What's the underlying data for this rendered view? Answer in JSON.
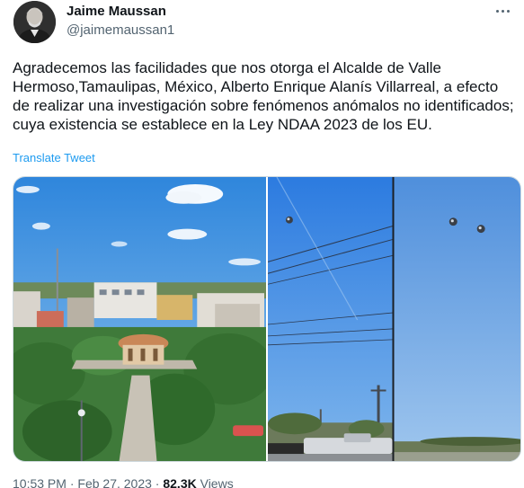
{
  "author": {
    "display_name": "Jaime Maussan",
    "handle": "@jaimemaussan1",
    "avatar_icon": "profile-photo"
  },
  "tweet": {
    "text": "Agradecemos las facilidades que nos otorga el Alcalde de Valle Hermoso,Tamaulipas, México, Alberto Enrique Alanís Villarreal, a efecto de realizar una investigación sobre fenómenos anómalos no identificados; cuya existencia se establece en la Ley NDAA 2023 de los EU.",
    "translate_label": "Translate Tweet",
    "time": "10:53 PM",
    "separator": "·",
    "date": "Feb 27, 2023",
    "views_count": "82.3K",
    "views_label": "Views"
  },
  "media": {
    "photos": [
      {
        "icon": "town-plaza-photo"
      },
      {
        "icon": "sky-objects-photo"
      }
    ]
  },
  "colors": {
    "link": "#1d9bf0",
    "secondary_text": "#536471",
    "primary_text": "#0f1419"
  },
  "icons": {
    "more": "more-horizontal-icon"
  }
}
